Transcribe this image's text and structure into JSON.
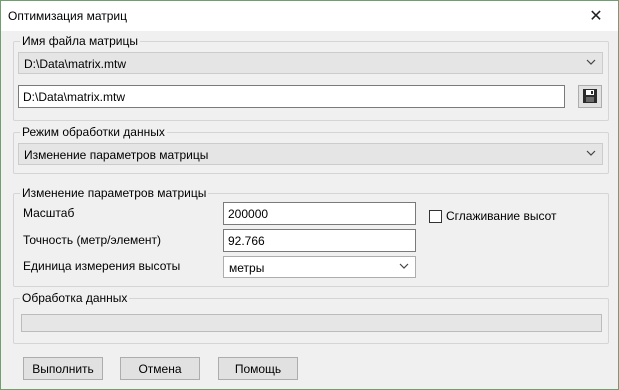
{
  "window": {
    "title": "Оптимизация матриц",
    "close_icon": "✕"
  },
  "file_group": {
    "label": "Имя файла матрицы",
    "combo_value": "D:\\Data\\matrix.mtw",
    "edit_value": "D:\\Data\\matrix.mtw",
    "save_icon": "floppy-disk"
  },
  "mode_group": {
    "label": "Режим обработки данных",
    "combo_value": "Изменение параметров матрицы"
  },
  "params_group": {
    "label": "Изменение параметров матрицы",
    "scale_label": "Масштаб",
    "scale_value": "200000",
    "precision_label": "Точность (метр/элемент)",
    "precision_value": "92.766",
    "unit_label": "Единица измерения высоты",
    "unit_value": "метры",
    "smoothing_label": "Сглаживание высот",
    "smoothing_checked": false
  },
  "processing_group": {
    "label": "Обработка данных",
    "progress": 0
  },
  "buttons": {
    "run": "Выполнить",
    "cancel": "Отмена",
    "help": "Помощь"
  }
}
